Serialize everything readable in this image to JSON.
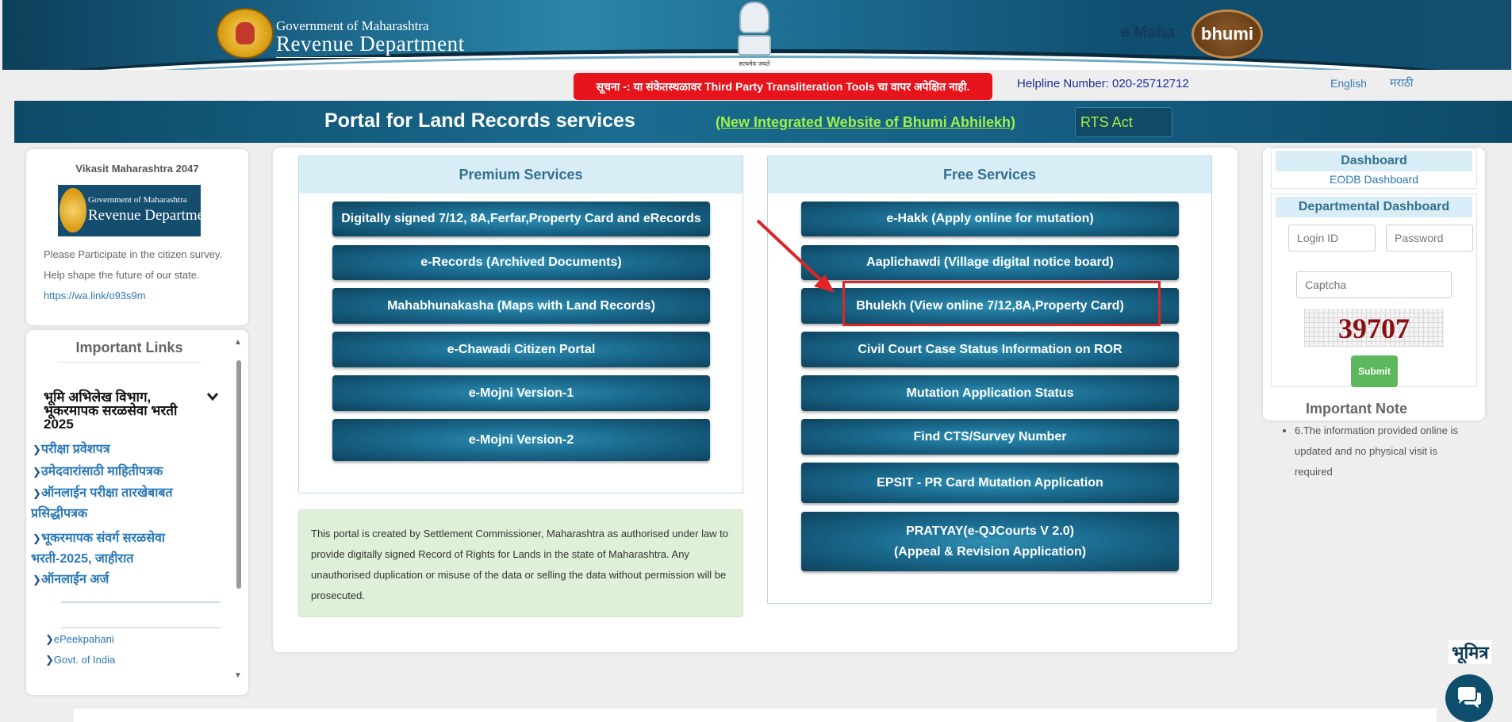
{
  "header": {
    "dept_small": "Government of Maharashtra",
    "dept_large": "Revenue Department",
    "emblem_caption": "सत्यमेव जयते",
    "mahabhumi_prefix": "e Maha",
    "mahabhumi_badge": "bhumi",
    "notice": "सूचना -: या संकेतस्थळावर Third Party Transliteration Tools चा वापर अपेक्षित नाही.",
    "helpline": "Helpline Number: 020-25712712",
    "lang_english": "English",
    "lang_marathi": "मराठी"
  },
  "banner": {
    "title": "Portal for Land Records services",
    "new_site_link": "(New Integrated Website of Bhumi Abhilekh)",
    "rts_act": "RTS Act"
  },
  "left": {
    "vikasit_title": "Vikasit Maharashtra 2047",
    "mini_logo_small": "Government of Maharashtra",
    "mini_logo_large": "Revenue Department",
    "survey_text": "Please Participate in the citizen survey. Help shape the future of our state.",
    "survey_link": "https://wa.link/o93s9m",
    "links_title": "Important Links",
    "accordion_head": "भूमि अभिलेख विभाग, भूकरमापक सरळसेवा भरती 2025",
    "marathi_links": [
      "परीक्षा प्रवेशपत्र",
      "उमेदवारांसाठी माहितीपत्रक",
      "ऑनलाईन परीक्षा तारखेबाबत",
      "प्रसिद्धीपत्रक",
      "भूकरमापक संवर्ग सरळसेवा",
      "भरती-2025, जाहीरात",
      "ऑनलाईन अर्ज"
    ],
    "english_links": [
      "ePeekpahani",
      "Govt. of India"
    ]
  },
  "premium": {
    "title": "Premium Services",
    "buttons": [
      "Digitally signed 7/12, 8A,Ferfar,Property Card and eRecords",
      "e-Records (Archived Documents)",
      "Mahabhunakasha (Maps with Land Records)",
      "e-Chawadi Citizen Portal",
      "e-Mojni Version-1",
      "e-Mojni Version-2"
    ]
  },
  "free": {
    "title": "Free Services",
    "buttons": [
      "e-Hakk (Apply online for mutation)",
      "Aaplichawdi (Village digital notice board)",
      "Bhulekh (View online 7/12,8A,Property Card)",
      "Civil Court Case Status Information on ROR",
      "Mutation Application Status",
      "Find CTS/Survey Number",
      "EPSIT - PR Card Mutation Application"
    ],
    "pratyay_line1": "PRATYAY(e-QJCourts V 2.0)",
    "pratyay_line2": "(Appeal & Revision Application)"
  },
  "disclaimer": "This portal is created by Settlement Commissioner, Maharashtra as authorised under law to provide digitally signed Record of Rights for Lands in the state of Maharashtra. Any unauthorised duplication or misuse of the data or selling the data without permission will be prosecuted.",
  "right": {
    "dashboard_title": "Dashboard",
    "eodb_link": "EODB Dashboard",
    "dept_dashboard_title": "Departmental Dashboard",
    "login_placeholder": "Login ID",
    "password_placeholder": "Password",
    "captcha_placeholder": "Captcha",
    "captcha_value": "39707",
    "submit_label": "Submit",
    "important_note_title": "Important Note",
    "note_item": "6.The information provided online is updated and no physical visit is required"
  },
  "bhumitra_label": "भूमित्र",
  "colors": {
    "banner": "#155e82",
    "notice_red": "#e8141c",
    "link_green": "#9ff048",
    "panel_head": "#d9edf7",
    "annotation_red": "#e02424"
  }
}
